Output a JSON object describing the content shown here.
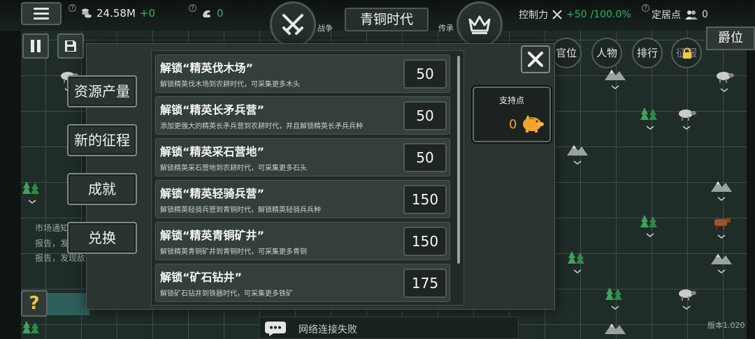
{
  "topbar": {
    "resources_value": "24.58M",
    "resources_delta": "+0",
    "population_value": "0",
    "battle_label": "战争",
    "era_name": "青铜时代",
    "legacy_label": "传承",
    "control_label": "控制力",
    "control_delta": "+50",
    "control_value": "/100.0%",
    "settle_label": "定居点",
    "settle_value": "0"
  },
  "right_nav": {
    "title_tab": "爵位",
    "official": "官位",
    "people": "人物",
    "ranking": "排行",
    "locked": "征服"
  },
  "left_notices": [
    "市场通知",
    "报告，发现",
    "报告，发现敌"
  ],
  "modal": {
    "side_buttons": [
      "资源产量",
      "新的征程",
      "成就",
      "兑换"
    ],
    "items": [
      {
        "title": "解锁“精英伐木场”",
        "desc": "解锁精英伐木场到农耕时代，可采集更多木头",
        "cost": "50"
      },
      {
        "title": "解锁“精英长矛兵营”",
        "desc": "添加更强大的精英长矛兵营到农耕时代，并且解锁精英长矛兵兵种",
        "cost": "50"
      },
      {
        "title": "解锁“精英采石营地”",
        "desc": "解锁精英采石营地到农耕时代，可采集更多石头",
        "cost": "50"
      },
      {
        "title": "解锁“精英轻骑兵营”",
        "desc": "解锁精英轻骑兵营到青铜时代，解锁精英轻骑兵兵种",
        "cost": "150"
      },
      {
        "title": "解锁“精英青铜矿井”",
        "desc": "解锁精英青铜矿井到青铜时代，可采集更多青铜",
        "cost": "150"
      },
      {
        "title": "解锁“矿石钻井”",
        "desc": "解锁矿石钻井到铁器时代，可采集更多铁矿",
        "cost": "175"
      }
    ],
    "support_title": "支持点",
    "support_value": "0"
  },
  "chat": {
    "message": "网络连接失败"
  },
  "version": "版本1.020",
  "help_label": "?",
  "colors": {
    "accent_green": "#2fb468",
    "gold": "#f0a52c",
    "help_yellow": "#f2c542"
  }
}
